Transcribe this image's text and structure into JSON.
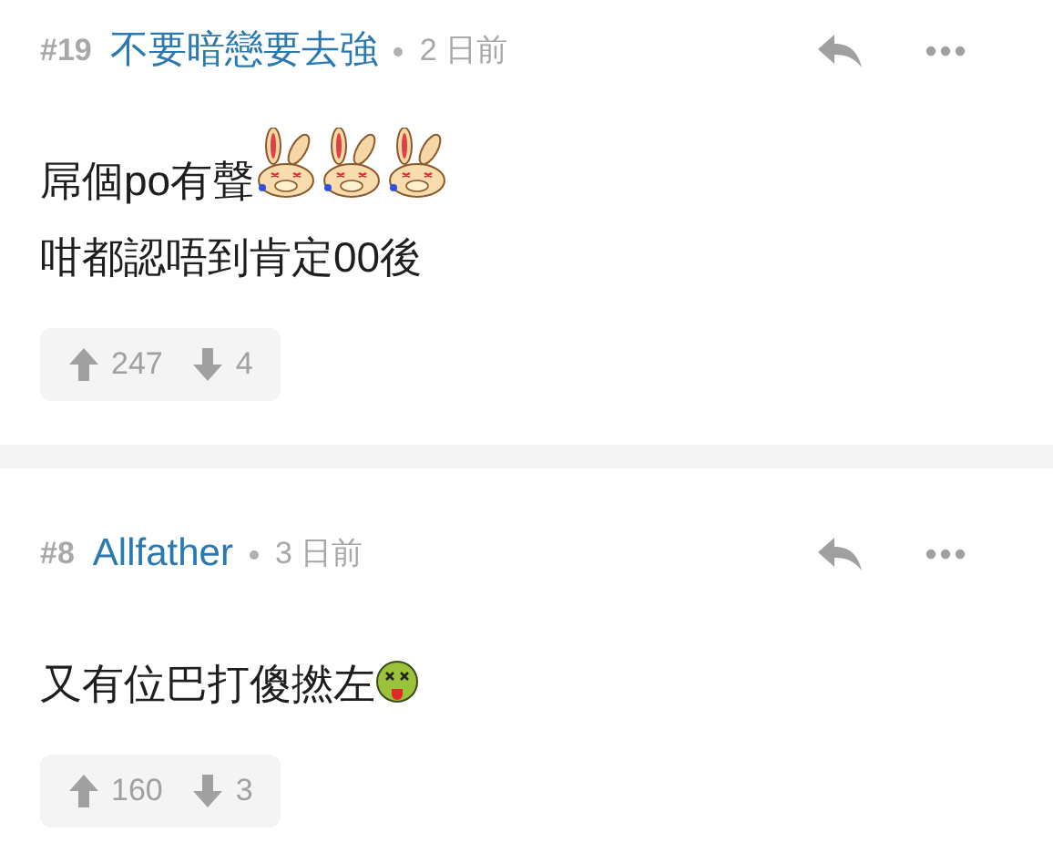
{
  "comments": [
    {
      "floor": "#19",
      "author": "不要暗戀要去強",
      "time": "2 日前",
      "lines": [
        {
          "text": "屌個po有聲",
          "emoticons": [
            {
              "kind": "bunny"
            },
            {
              "kind": "bunny"
            },
            {
              "kind": "bunny"
            }
          ]
        },
        {
          "text": "咁都認唔到肯定00後"
        }
      ],
      "upvotes": "247",
      "downvotes": "4"
    },
    {
      "floor": "#8",
      "author": "Allfather",
      "time": "3 日前",
      "lines": [
        {
          "text": "又有位巴打傻撚左",
          "emoticons": [
            {
              "kind": "sick"
            }
          ]
        }
      ],
      "upvotes": "160",
      "downvotes": "3"
    }
  ]
}
